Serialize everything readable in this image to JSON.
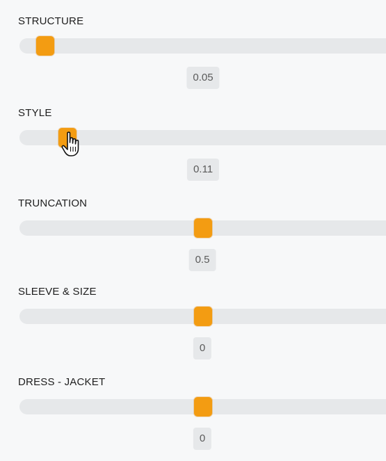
{
  "sliders": [
    {
      "label": "STRUCTURE",
      "value": "0.05",
      "position": 0.07
    },
    {
      "label": "STYLE",
      "value": "0.11",
      "position": 0.13
    },
    {
      "label": "TRUNCATION",
      "value": "0.5",
      "position": 0.5
    },
    {
      "label": "SLEEVE & SIZE",
      "value": "0",
      "position": 0.5
    },
    {
      "label": "DRESS - JACKET",
      "value": "0",
      "position": 0.5
    }
  ],
  "colors": {
    "thumb": "#f39c12",
    "track": "#e6e8ea",
    "background": "#f7f8f9"
  },
  "cursor": {
    "icon": "hand-pointer-icon"
  }
}
